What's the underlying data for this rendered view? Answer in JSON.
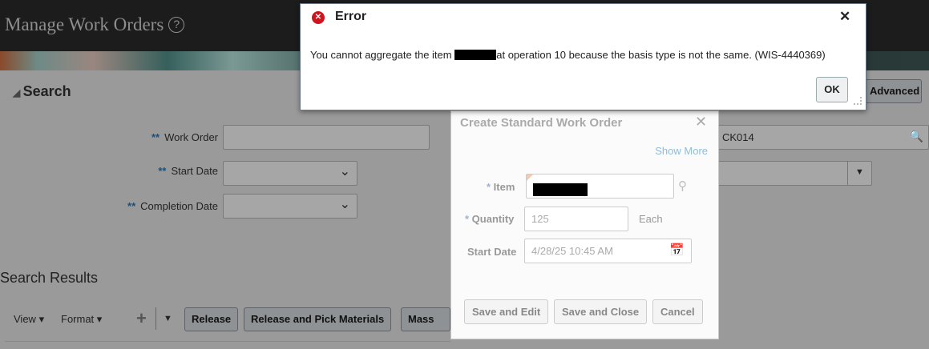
{
  "page": {
    "title": "Manage Work Orders",
    "help_icon": "?"
  },
  "search": {
    "heading": "Search",
    "advanced_label": "Advanced",
    "fields": {
      "work_order": "Work Order",
      "start_date": "Start Date",
      "completion_date": "Completion Date"
    },
    "org_value": "CK014"
  },
  "results": {
    "heading": "Search Results",
    "view": "View",
    "format": "Format",
    "buttons": [
      "Release",
      "Release and Pick Materials",
      "Mass Ac"
    ]
  },
  "error_dialog": {
    "title": "Error",
    "message_before": "You cannot aggregate the item",
    "message_after": "at operation 10 because the basis type is not the same. (WIS-4440369)",
    "ok": "OK"
  },
  "create_dialog": {
    "title": "Create Standard Work Order",
    "show_more": "Show More",
    "item_label": "Item",
    "quantity_label": "Quantity",
    "quantity_value": "125",
    "uom": "Each",
    "start_date_label": "Start Date",
    "start_date_value": "4/28/25 10:45 AM",
    "buttons": {
      "save_edit": "Save and Edit",
      "save_close": "Save and Close",
      "cancel": "Cancel"
    }
  }
}
